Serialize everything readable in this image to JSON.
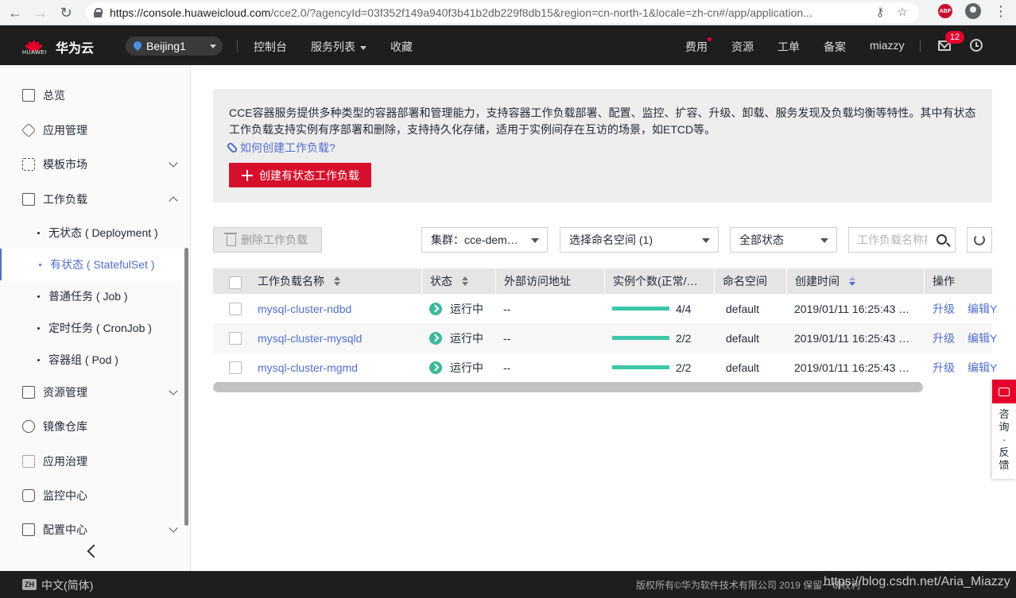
{
  "browser": {
    "url_host": "https://console.huaweicloud.com",
    "url_rest": "/cce2.0/?agencyId=03f352f149a940f3b41b2db229f8db15&region=cn-north-1&locale=zh-cn#/app/application...",
    "ext_abp": "ABP"
  },
  "header": {
    "logo_small": "HUAWEI",
    "brand": "华为云",
    "region": "Beijing1",
    "nav": [
      "控制台",
      "服务列表",
      "收藏"
    ],
    "right": [
      "费用",
      "资源",
      "工单",
      "备案",
      "miazzy"
    ],
    "message_count": "12"
  },
  "sidebar": {
    "items": [
      {
        "label": "总览",
        "icon": "monitor-icon"
      },
      {
        "label": "应用管理",
        "icon": "cube-icon"
      },
      {
        "label": "模板市场",
        "icon": "grid-icon"
      },
      {
        "label": "工作负载",
        "icon": "workload-icon"
      }
    ],
    "sub_items": [
      {
        "label": "无状态 ( Deployment )"
      },
      {
        "label": "有状态 ( StatefulSet )"
      },
      {
        "label": "普通任务 ( Job )"
      },
      {
        "label": "定时任务 ( CronJob )"
      },
      {
        "label": "容器组 ( Pod )"
      }
    ],
    "items_after": [
      {
        "label": "资源管理",
        "icon": "server-icon"
      },
      {
        "label": "镜像仓库",
        "icon": "registry-icon"
      },
      {
        "label": "应用治理",
        "icon": "governance-icon"
      },
      {
        "label": "监控中心",
        "icon": "monitor-chart-icon"
      },
      {
        "label": "配置中心",
        "icon": "config-icon"
      }
    ]
  },
  "info": {
    "text": "CCE容器服务提供多种类型的容器部署和管理能力，支持容器工作负载部署、配置、监控、扩容、升级、卸载、服务发现及负载均衡等特性。其中有状态工作负载支持实例有序部署和删除，支持持久化存储，适用于实例间存在互访的场景，如ETCD等。",
    "link": "如何创建工作负载?",
    "create_button": "创建有状态工作负载"
  },
  "toolbar": {
    "delete_button": "删除工作负载",
    "cluster_select": "集群：cce-dem…",
    "namespace_select": "选择命名空间 (1)",
    "status_select": "全部状态",
    "search_placeholder": "工作负载名称搜索"
  },
  "table": {
    "columns": [
      "工作负载名称",
      "状态",
      "外部访问地址",
      "实例个数(正常/…",
      "命名空间",
      "创建时间",
      "操作"
    ],
    "rows": [
      {
        "name": "mysql-cluster-ndbd",
        "status": "运行中",
        "external": "--",
        "instances": "4/4",
        "ratio": 1.0,
        "namespace": "default",
        "created": "2019/01/11 16:25:43 …",
        "op1": "升级",
        "op2": "编辑Y"
      },
      {
        "name": "mysql-cluster-mysqld",
        "status": "运行中",
        "external": "--",
        "instances": "2/2",
        "ratio": 1.0,
        "namespace": "default",
        "created": "2019/01/11 16:25:43 …",
        "op1": "升级",
        "op2": "编辑Y"
      },
      {
        "name": "mysql-cluster-mgmd",
        "status": "运行中",
        "external": "--",
        "instances": "2/2",
        "ratio": 1.0,
        "namespace": "default",
        "created": "2019/01/11 16:25:43 …",
        "op1": "升级",
        "op2": "编辑Y"
      }
    ]
  },
  "feedback": {
    "label": "咨询·反馈"
  },
  "footer": {
    "lang_badge": "ZH",
    "lang": "中文(简体)",
    "copyright": "版权所有©华为软件技术有限公司 2019 保留一切权利",
    "watermark": "https://blog.csdn.net/Aria_Miazzy"
  }
}
